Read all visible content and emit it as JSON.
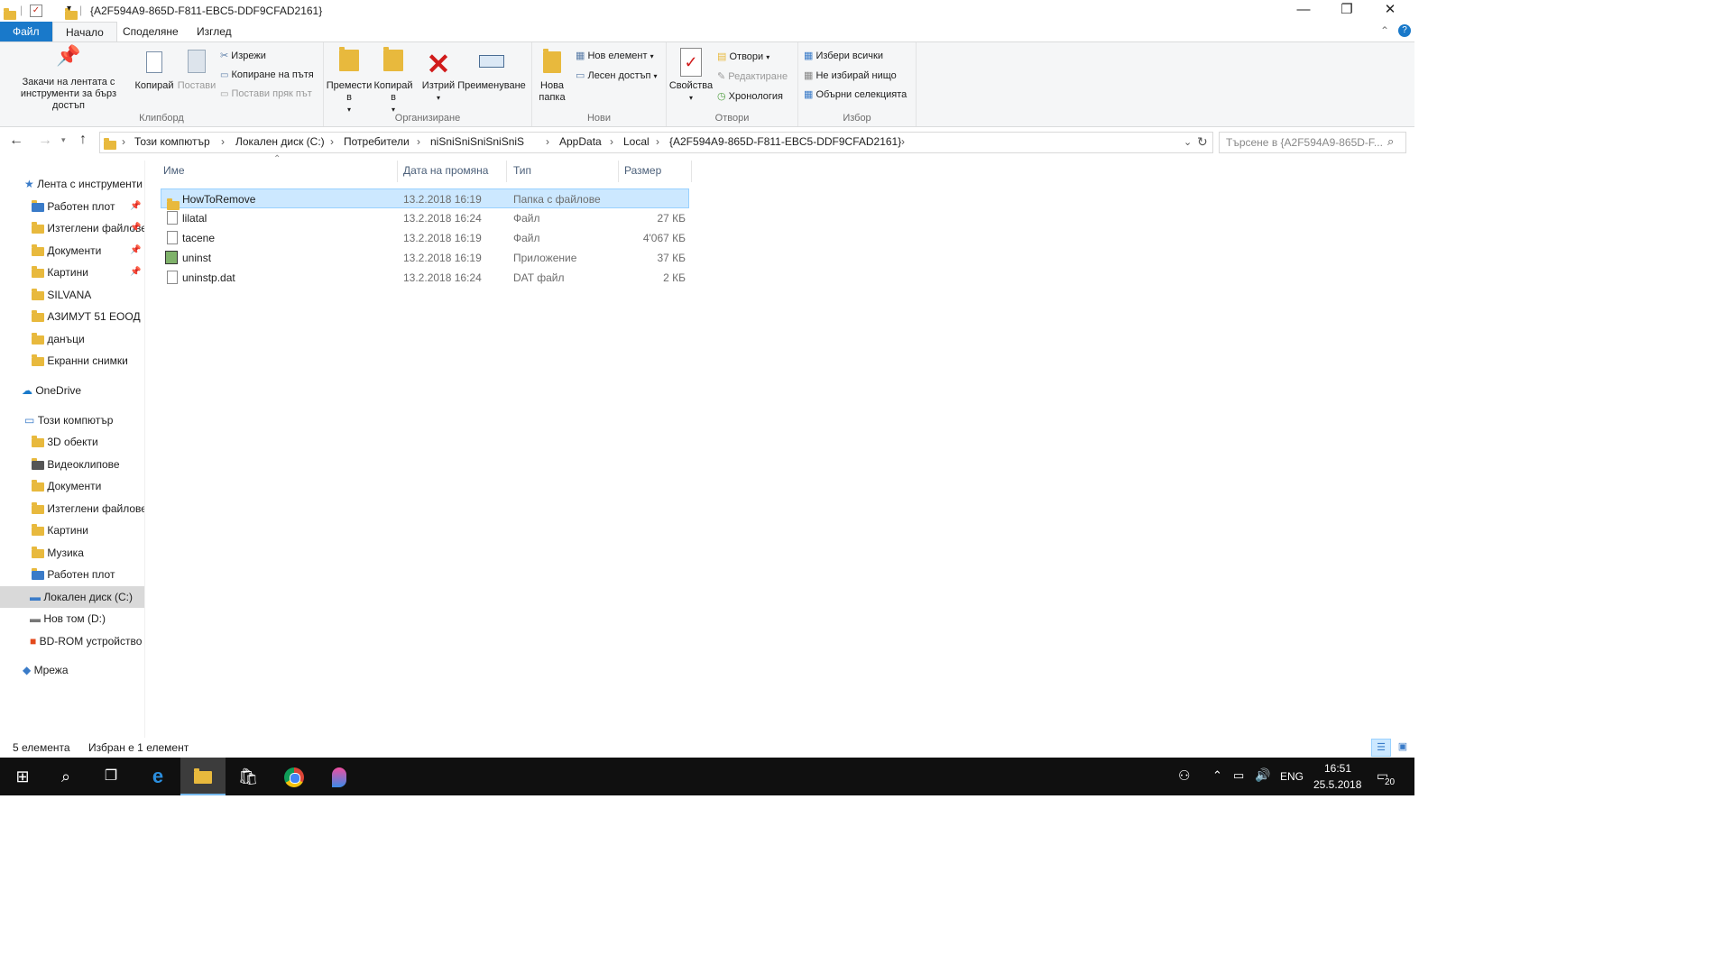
{
  "window": {
    "title": "{A2F594A9-865D-F811-EBC5-DDF9CFAD2161}",
    "minimize": "—",
    "maximize": "❐",
    "close": "✕"
  },
  "ribbon_tabs": [
    "Файл",
    "Начало",
    "Споделяне",
    "Изглед"
  ],
  "ribbon": {
    "pin_label": "Закачи на лентата с инструменти за бърз достъп",
    "copy": "Копирай",
    "paste": "Постави",
    "cut": "Изрежи",
    "copy_path": "Копиране на пътя",
    "paste_shortcut": "Постави пряк път",
    "group_clipboard": "Клипборд",
    "move_to": "Премести в",
    "copy_to": "Копирай в",
    "delete": "Изтрий",
    "rename": "Преименуване",
    "group_organize": "Организиране",
    "new_folder": "Нова папка",
    "new_item": "Нов елемент",
    "easy_access": "Лесен достъп",
    "group_new": "Нови",
    "properties": "Свойства",
    "open": "Отвори",
    "edit": "Редактиране",
    "history": "Хронология",
    "group_open": "Отвори",
    "select_all": "Избери всички",
    "select_none": "Не избирай нищо",
    "invert_selection": "Обърни селекцията",
    "group_select": "Избор"
  },
  "address": {
    "crumbs": [
      "Този компютър",
      "Локален диск (C:)",
      "Потребители",
      "niSniSniSniSniSniS",
      "AppData",
      "Local",
      "{A2F594A9-865D-F811-EBC5-DDF9CFAD2161}"
    ],
    "search_placeholder": "Търсене в {A2F594A9-865D-F..."
  },
  "nav": {
    "quick_access": "Лента с инструменти за бърз достъп",
    "quick_items": [
      "Работен плот",
      "Изтеглени файлове",
      "Документи",
      "Картини",
      "SILVANA",
      "АЗИМУТ 51 ЕООД",
      "данъци",
      "Екранни снимки"
    ],
    "onedrive": "OneDrive",
    "this_pc": "Този компютър",
    "pc_items": [
      "3D обекти",
      "Видеоклипове",
      "Документи",
      "Изтеглени файлове",
      "Картини",
      "Музика",
      "Работен плот",
      "Локален диск (C:)",
      "Нов том (D:)",
      "BD-ROM устройство"
    ],
    "network": "Мрежа"
  },
  "columns": [
    "Име",
    "Дата на промяна",
    "Тип",
    "Размер"
  ],
  "files": [
    {
      "name": "HowToRemove",
      "date": "13.2.2018 16:19",
      "type": "Папка с файлове",
      "size": ""
    },
    {
      "name": "lilatal",
      "date": "13.2.2018 16:24",
      "type": "Файл",
      "size": "27 КБ"
    },
    {
      "name": "tacene",
      "date": "13.2.2018 16:19",
      "type": "Файл",
      "size": "4'067 КБ"
    },
    {
      "name": "uninst",
      "date": "13.2.2018 16:19",
      "type": "Приложение",
      "size": "37 КБ"
    },
    {
      "name": "uninstp.dat",
      "date": "13.2.2018 16:24",
      "type": "DAT файл",
      "size": "2 КБ"
    }
  ],
  "status": {
    "count": "5 елемента",
    "selected": "Избран е 1 елемент"
  },
  "taskbar": {
    "lang": "ENG",
    "time": "16:51",
    "date": "25.5.2018",
    "notifications": "20"
  }
}
